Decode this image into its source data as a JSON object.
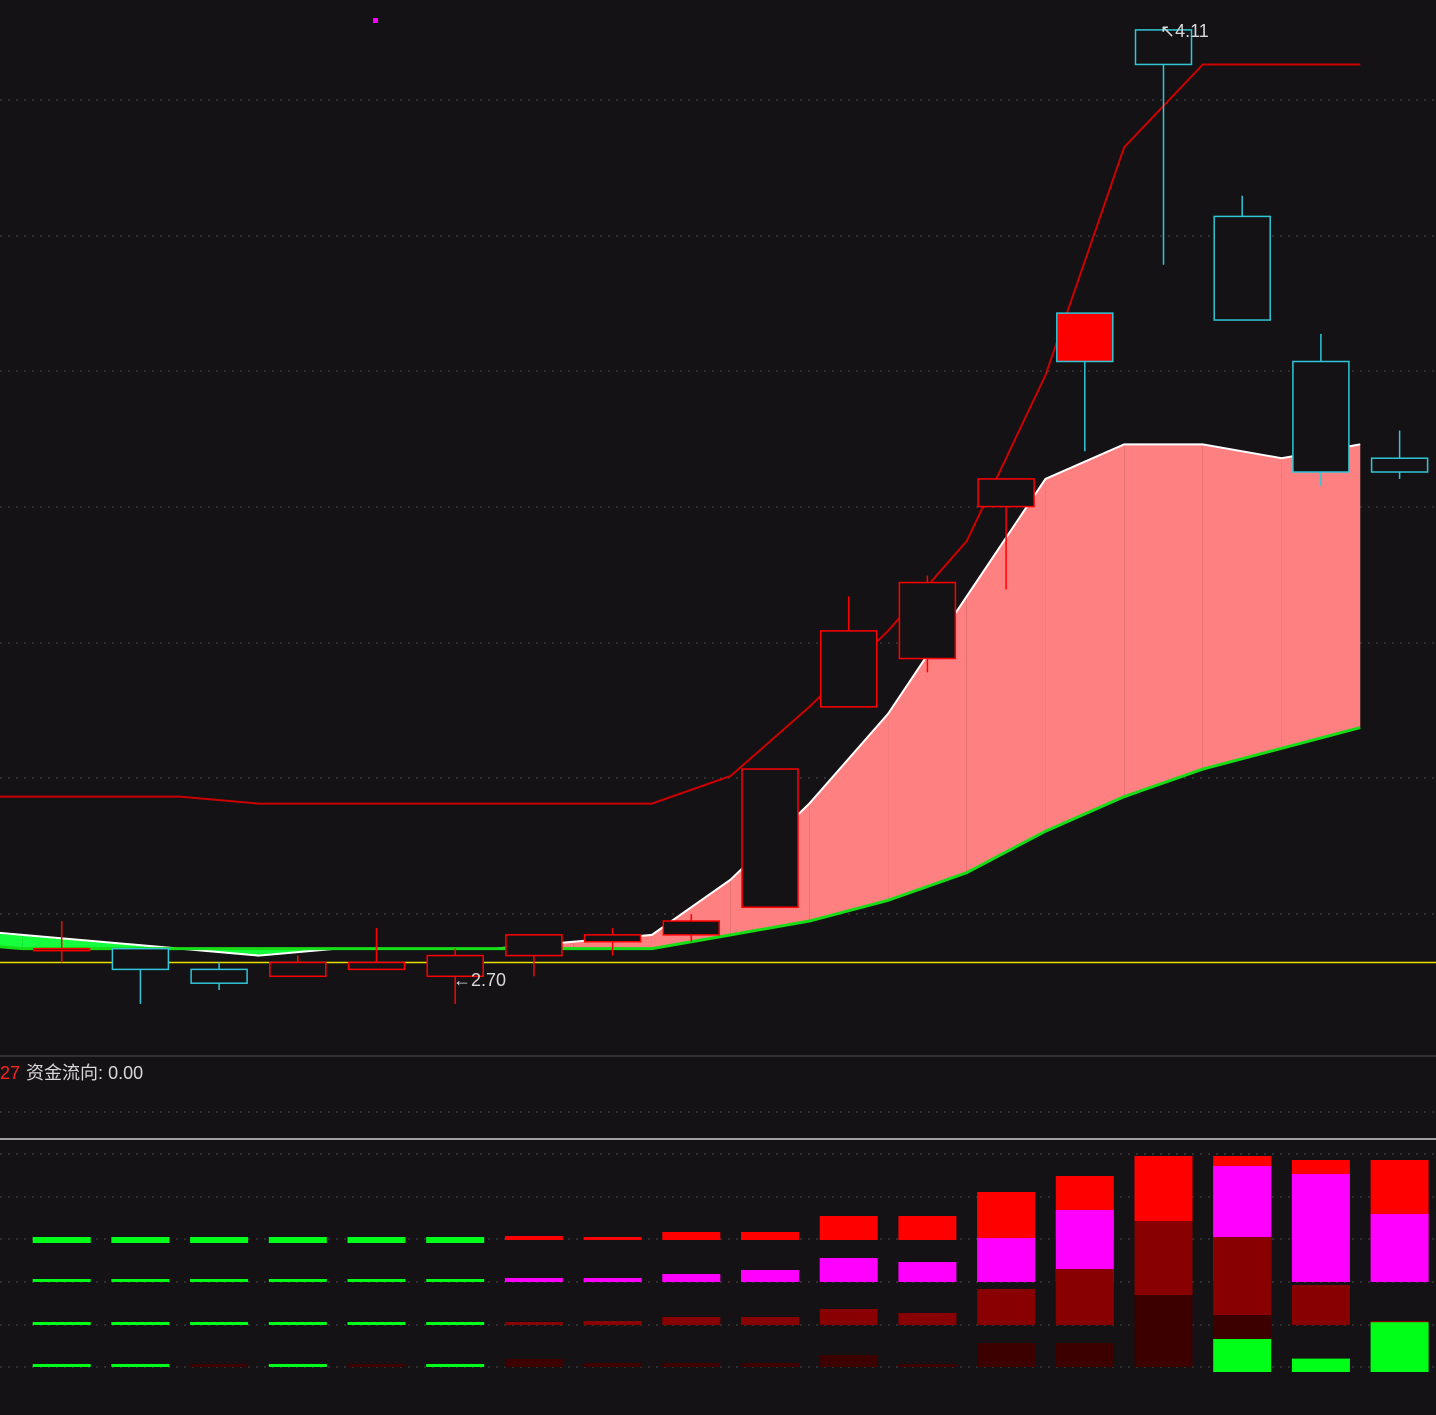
{
  "indicator": {
    "prefix": "27",
    "name": "资金流向:",
    "value": "0.00"
  },
  "annotations": {
    "high_label": "4.11",
    "low_label": "2.70"
  },
  "colors": {
    "background": "#141214",
    "grid": "#3a3a3a",
    "up": "#ff0000",
    "down": "#2fc6d8",
    "upper_band": "#cc0000",
    "cloud_up": "#ff8080",
    "cloud_down": "#16ff3c",
    "cloud_edge_top": "#ffffff",
    "cloud_edge_bottom": "#16dd16",
    "baseline": "#e8e000",
    "flow_large_buy": "#ff0000",
    "flow_buy": "#ff00ff",
    "flow_mid": "#880000",
    "flow_small": "#3c0000",
    "flow_sell": "#00ff18"
  },
  "chart_data": [
    {
      "type": "candlestick",
      "title": "",
      "xlabel": "",
      "ylabel": "",
      "ylim": [
        2.6,
        4.12
      ],
      "grid": true,
      "baseline": 2.76,
      "candles": [
        {
          "o": 2.78,
          "h": 2.82,
          "l": 2.76,
          "c": 2.78
        },
        {
          "o": 2.78,
          "h": 2.78,
          "l": 2.7,
          "c": 2.75
        },
        {
          "o": 2.75,
          "h": 2.76,
          "l": 2.72,
          "c": 2.73
        },
        {
          "o": 2.74,
          "h": 2.77,
          "l": 2.74,
          "c": 2.76
        },
        {
          "o": 2.75,
          "h": 2.81,
          "l": 2.75,
          "c": 2.76
        },
        {
          "o": 2.74,
          "h": 2.78,
          "l": 2.7,
          "c": 2.77
        },
        {
          "o": 2.77,
          "h": 2.8,
          "l": 2.74,
          "c": 2.8
        },
        {
          "o": 2.79,
          "h": 2.81,
          "l": 2.77,
          "c": 2.8
        },
        {
          "o": 2.8,
          "h": 2.83,
          "l": 2.79,
          "c": 2.82
        },
        {
          "o": 2.84,
          "h": 3.04,
          "l": 2.84,
          "c": 3.04
        },
        {
          "o": 3.13,
          "h": 3.29,
          "l": 3.13,
          "c": 3.24
        },
        {
          "o": 3.2,
          "h": 3.32,
          "l": 3.18,
          "c": 3.31
        },
        {
          "o": 3.42,
          "h": 3.44,
          "l": 3.3,
          "c": 3.46
        },
        {
          "o": 3.7,
          "h": 3.7,
          "l": 3.5,
          "c": 3.63
        },
        {
          "o": 4.11,
          "h": 4.11,
          "l": 3.77,
          "c": 4.06
        },
        {
          "o": 3.84,
          "h": 3.87,
          "l": 3.84,
          "c": 3.69
        },
        {
          "o": 3.63,
          "h": 3.67,
          "l": 3.45,
          "c": 3.47
        },
        {
          "o": 3.49,
          "h": 3.53,
          "l": 3.46,
          "c": 3.47
        }
      ],
      "upper_band": [
        3.0,
        3.0,
        3.0,
        3.0,
        2.99,
        2.99,
        2.99,
        2.99,
        2.99,
        2.99,
        3.03,
        3.13,
        3.24,
        3.37,
        3.61,
        3.94,
        4.06,
        4.06,
        4.06
      ],
      "cloud_top": [
        2.81,
        2.8,
        2.79,
        2.78,
        2.77,
        2.78,
        2.78,
        2.78,
        2.79,
        2.8,
        2.88,
        2.99,
        3.12,
        3.29,
        3.46,
        3.51,
        3.51,
        3.49,
        3.51
      ],
      "cloud_bottom": [
        2.79,
        2.78,
        2.78,
        2.78,
        2.78,
        2.78,
        2.78,
        2.78,
        2.78,
        2.78,
        2.8,
        2.82,
        2.85,
        2.89,
        2.95,
        3.0,
        3.04,
        3.07,
        3.1
      ]
    },
    {
      "type": "bar",
      "title": "",
      "xlabel": "",
      "ylabel": "",
      "series": [
        {
          "values": [
            0.3,
            0.3,
            0.3,
            0.3,
            0.3,
            0.3,
            -0.1,
            -0.05,
            -0.2,
            -0.2,
            -0.6,
            -0.6,
            -1.2,
            -1.6,
            -2.1,
            -2.1,
            -2.0,
            -2.0
          ]
        },
        {
          "values": [
            0.15,
            0.15,
            0.15,
            0.1,
            0.15,
            0.1,
            -0.1,
            -0.1,
            -0.2,
            -0.3,
            -0.6,
            -0.5,
            -1.1,
            -1.8,
            -1.4,
            -2.9,
            -2.7,
            -1.7
          ]
        },
        {
          "values": [
            0.1,
            0.1,
            0.1,
            0.1,
            0.05,
            0.1,
            -0.05,
            -0.1,
            -0.2,
            -0.2,
            -0.4,
            -0.3,
            -0.9,
            -1.4,
            -2.6,
            -2.2,
            -1.0,
            -0.1
          ]
        },
        {
          "values": [
            0.05,
            0.05,
            0.0,
            0.05,
            0.0,
            0.1,
            -0.2,
            -0.1,
            -0.1,
            -0.1,
            -0.3,
            0.0,
            -0.6,
            -0.6,
            -1.8,
            -1.3,
            0.0,
            0.0
          ]
        },
        {
          "values": [
            0,
            0,
            0,
            0,
            0,
            0,
            0,
            0,
            0,
            0,
            0,
            0,
            0,
            0,
            0,
            1.0,
            0.3,
            1.6
          ]
        }
      ]
    }
  ]
}
